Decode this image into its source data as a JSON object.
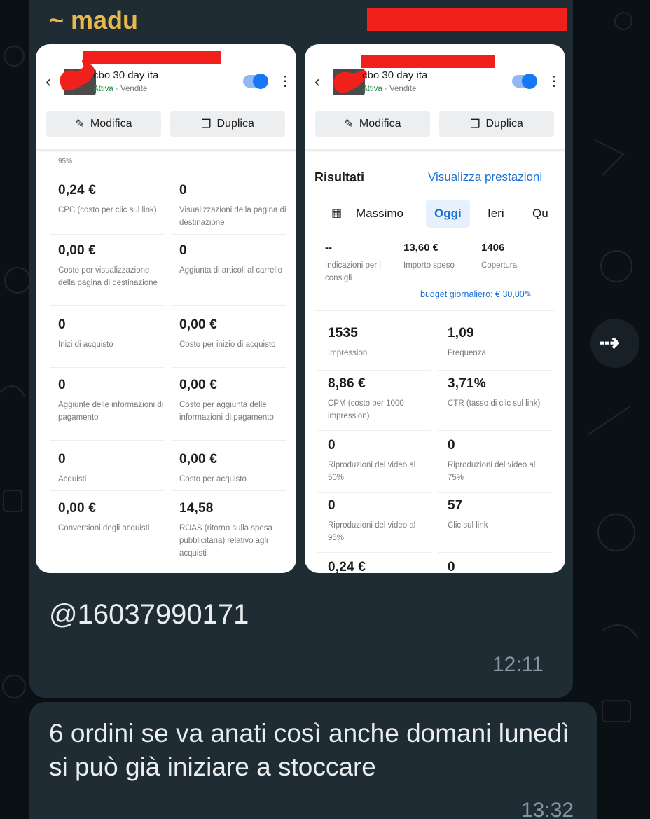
{
  "chat": {
    "sender": "~ madu",
    "mention": "@16037990171",
    "time1": "12:11",
    "message": "6 ordini se va anati così anche domani lunedì si può già iniziare a stoccare",
    "time2": "13:32"
  },
  "icons": {
    "forward": "forward-icon",
    "back": "chevron-left-icon",
    "edit": "pencil-icon",
    "duplicate": "duplicate-icon",
    "more": "kebab-icon",
    "calendar": "calendar-icon"
  },
  "colors": {
    "sender": "#e7b84e",
    "link": "#1b6fd0",
    "active": "#1e8e3e",
    "redaction": "#f0201a"
  },
  "left_card": {
    "campaign": "cbo 30 day ita",
    "status": "Attiva",
    "objective": "· Vendite",
    "toggle_on": true,
    "edit_label": "Modifica",
    "duplicate_label": "Duplica",
    "top_partial": "95%",
    "metrics": [
      {
        "value": "0,24 €",
        "label": "CPC (costo per clic sul link)"
      },
      {
        "value": "0",
        "label": "Visualizzazioni della pagina di destinazione"
      },
      {
        "value": "0,00 €",
        "label": "Costo per visualizzazione della pagina di destinazione"
      },
      {
        "value": "0",
        "label": "Aggiunta di articoli al carrello"
      },
      {
        "value": "0",
        "label": "Inizi di acquisto"
      },
      {
        "value": "0,00 €",
        "label": "Costo per inizio di acquisto"
      },
      {
        "value": "0",
        "label": "Aggiunte delle informazioni di pagamento"
      },
      {
        "value": "0,00 €",
        "label": "Costo per aggiunta delle informazioni di pagamento"
      },
      {
        "value": "0",
        "label": "Acquisti"
      },
      {
        "value": "0,00 €",
        "label": "Costo per acquisto"
      },
      {
        "value": "0,00 €",
        "label": "Conversioni degli acquisti"
      },
      {
        "value": "14,58",
        "label": "ROAS (ritorno sulla spesa pubblicitaria) relativo agli acquisti"
      }
    ]
  },
  "right_card": {
    "campaign": "cbo 30 day ita",
    "status": "Attiva",
    "objective": "· Vendite",
    "toggle_on": true,
    "edit_label": "Modifica",
    "duplicate_label": "Duplica",
    "results_title": "Risultati",
    "results_link": "Visualizza prestazioni",
    "tabs": [
      "Massimo",
      "Oggi",
      "Ieri",
      "Qu"
    ],
    "active_tab": "Oggi",
    "summary": [
      {
        "value": "--",
        "label": "Indicazioni per i consigli"
      },
      {
        "value": "13,60 €",
        "label": "Importo speso"
      },
      {
        "value": "1406",
        "label": "Copertura"
      }
    ],
    "budget": "budget giornaliero: € 30,00",
    "metrics": [
      {
        "value": "1535",
        "label": "Impression"
      },
      {
        "value": "1,09",
        "label": "Frequenza"
      },
      {
        "value": "8,86 €",
        "label": "CPM (costo per 1000 impression)"
      },
      {
        "value": "3,71%",
        "label": "CTR (tasso di clic sul link)"
      },
      {
        "value": "0",
        "label": "Riproduzioni del video al 50%"
      },
      {
        "value": "0",
        "label": "Riproduzioni del video al 75%"
      },
      {
        "value": "0",
        "label": "Riproduzioni del video al 95%"
      },
      {
        "value": "57",
        "label": "Clic sul link"
      },
      {
        "value": "0,24 €",
        "label": ""
      },
      {
        "value": "0",
        "label": ""
      }
    ]
  }
}
